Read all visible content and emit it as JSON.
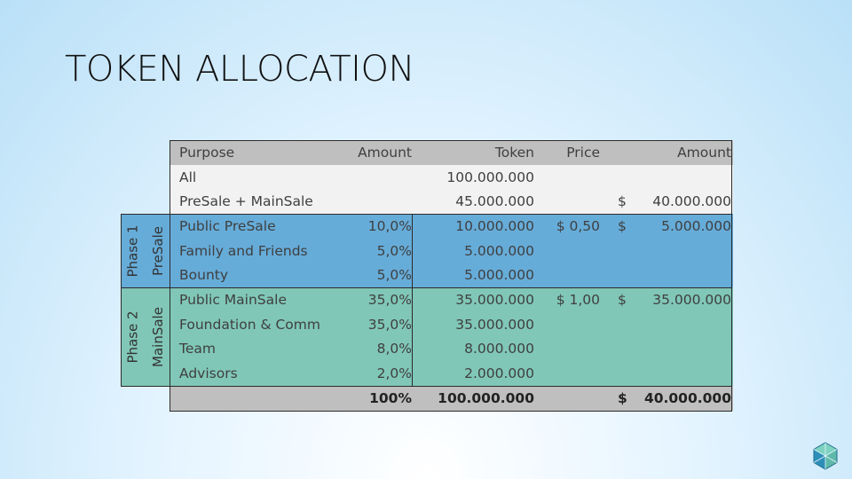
{
  "slide": {
    "title": "TOKEN ALLOCATION"
  },
  "table": {
    "headers": {
      "purpose": "Purpose",
      "percent": "Amount",
      "token": "Token",
      "price": "Price",
      "amount": "Amount"
    },
    "general_rows": [
      {
        "purpose": "All",
        "percent": "",
        "token": "100.000.000",
        "price": "",
        "currency": "",
        "amount": ""
      },
      {
        "purpose": "PreSale + MainSale",
        "percent": "",
        "token": "45.000.000",
        "price": "",
        "currency": "$",
        "amount": "40.000.000"
      }
    ],
    "phase1": {
      "label_phase": "Phase 1",
      "label_sale": "PreSale",
      "rows": [
        {
          "purpose": "Public PreSale",
          "percent": "10,0%",
          "token": "10.000.000",
          "price": "$ 0,50",
          "currency": "$",
          "amount": "5.000.000"
        },
        {
          "purpose": "Family and Friends",
          "percent": "5,0%",
          "token": "5.000.000",
          "price": "",
          "currency": "",
          "amount": ""
        },
        {
          "purpose": "Bounty",
          "percent": "5,0%",
          "token": "5.000.000",
          "price": "",
          "currency": "",
          "amount": ""
        }
      ]
    },
    "phase2": {
      "label_phase": "Phase 2",
      "label_sale": "MainSale",
      "rows": [
        {
          "purpose": "Public MainSale",
          "percent": "35,0%",
          "token": "35.000.000",
          "price": "$ 1,00",
          "currency": "$",
          "amount": "35.000.000"
        },
        {
          "purpose": "Foundation & Community",
          "percent": "35,0%",
          "token": "35.000.000",
          "price": "",
          "currency": "",
          "amount": ""
        },
        {
          "purpose": "Team",
          "percent": "8,0%",
          "token": "8.000.000",
          "price": "",
          "currency": "",
          "amount": ""
        },
        {
          "purpose": "Advisors",
          "percent": "2,0%",
          "token": "2.000.000",
          "price": "",
          "currency": "",
          "amount": ""
        }
      ]
    },
    "total": {
      "percent": "100%",
      "token": "100.000.000",
      "currency": "$",
      "amount": "40.000.000"
    }
  },
  "colors": {
    "header": "#bfbfbf",
    "general": "#f2f2f2",
    "phase1": "#66acd9",
    "phase2": "#80c7b7"
  },
  "icons": {
    "logo": "hexagon-cube-logo-icon"
  }
}
